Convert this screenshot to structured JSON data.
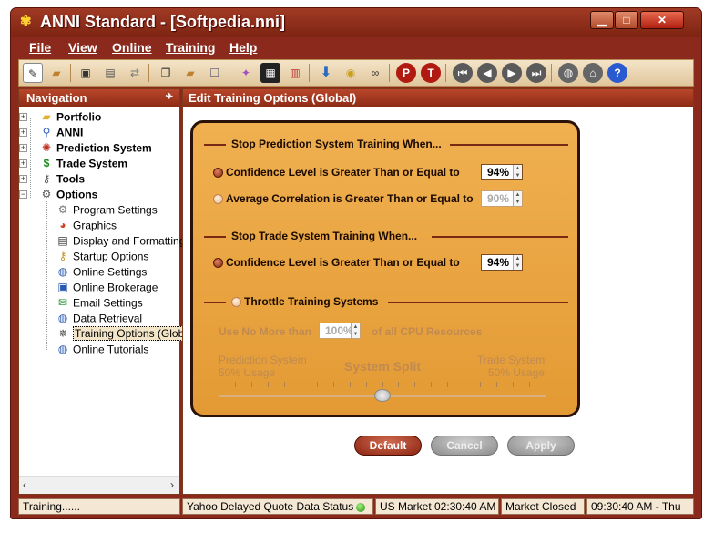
{
  "window": {
    "title": "ANNI Standard - [Softpedia.nni]"
  },
  "menu": [
    "File",
    "View",
    "Online",
    "Training",
    "Help"
  ],
  "toolbar_icons": [
    "new-icon",
    "open-icon",
    "save-icon",
    "save-as-icon",
    "exchange-icon",
    "copy-icon",
    "paste-icon",
    "duplicate-icon",
    "chart-icon",
    "grid-icon",
    "delete-icon",
    "download-icon",
    "data-icon",
    "binoculars-icon",
    "p-icon",
    "t-icon",
    "first-icon",
    "prev-icon",
    "next-icon",
    "last-icon",
    "globe-icon",
    "home-icon",
    "help-icon"
  ],
  "toolbar_glyphs": {
    "p": "P",
    "t": "T",
    "help": "?"
  },
  "navigation": {
    "title": "Navigation",
    "top": [
      {
        "label": "Portfolio",
        "icon": "folder-icon"
      },
      {
        "label": "ANNI",
        "icon": "magnifier-icon"
      },
      {
        "label": "Prediction System",
        "icon": "network-icon"
      },
      {
        "label": "Trade System",
        "icon": "dollar-icon"
      },
      {
        "label": "Tools",
        "icon": "key-icon"
      },
      {
        "label": "Options",
        "icon": "options-icon"
      }
    ],
    "options": [
      {
        "label": "Program Settings",
        "icon": "gear-icon"
      },
      {
        "label": "Graphics",
        "icon": "palette-icon"
      },
      {
        "label": "Display and Formatting",
        "icon": "table-icon"
      },
      {
        "label": "Startup Options",
        "icon": "key-icon"
      },
      {
        "label": "Online Settings",
        "icon": "globe-icon"
      },
      {
        "label": "Online Brokerage",
        "icon": "brokerage-icon"
      },
      {
        "label": "Email Settings",
        "icon": "email-icon"
      },
      {
        "label": "Data Retrieval",
        "icon": "retrieval-icon"
      },
      {
        "label": "Training Options (Globa",
        "icon": "training-icon"
      },
      {
        "label": "Online Tutorials",
        "icon": "tutorial-icon"
      }
    ]
  },
  "edit": {
    "title": "Edit Training Options (Global)",
    "stop_prediction": {
      "header": "Stop Prediction System Training When...",
      "confidence_label": "Confidence Level is Greater Than or Equal to",
      "confidence_value": "94%",
      "correlation_label": "Average Correlation is Greater Than or Equal to",
      "correlation_value": "90%"
    },
    "stop_trade": {
      "header": "Stop Trade System Training When...",
      "confidence_label": "Confidence Level is Greater Than or Equal to",
      "confidence_value": "94%"
    },
    "throttle": {
      "header": "Throttle Training Systems",
      "use_label": "Use No More than",
      "cpu_value": "100%",
      "cpu_suffix": "of all CPU Resources",
      "left_label": "Prediction System",
      "left_usage": "50% Usage",
      "center_label": "System Split",
      "right_label": "Trade System",
      "right_usage": "50% Usage",
      "split_fraction": 0.5
    },
    "buttons": {
      "default": "Default",
      "cancel": "Cancel",
      "apply": "Apply"
    }
  },
  "status": {
    "text": "Training......",
    "quote": "Yahoo Delayed Quote Data Status",
    "market_time": "US Market 02:30:40 AM",
    "market_state": "Market Closed",
    "local_time": "09:30:40 AM - Thu"
  },
  "colors": {
    "accent": "#8b2a1c",
    "panel": "#e8a53c"
  }
}
